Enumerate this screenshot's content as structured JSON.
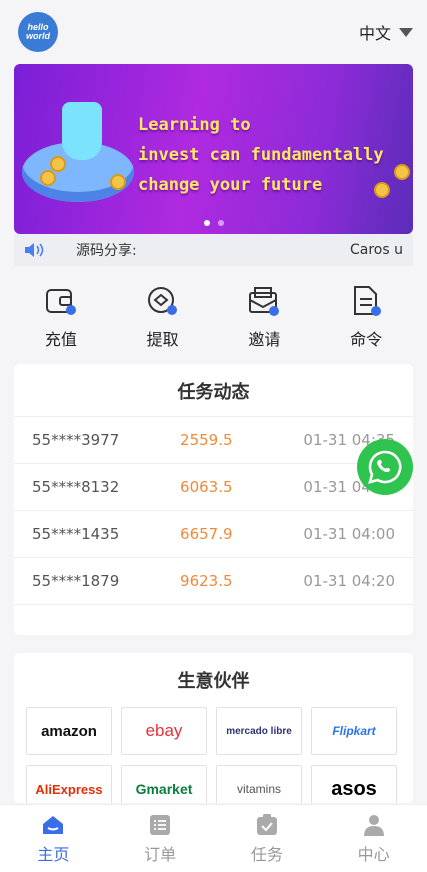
{
  "header": {
    "logo_line1": "hello",
    "logo_line2": "world",
    "language": "中文"
  },
  "banner": {
    "line1": "Learning to",
    "line2": "invest can fundamentally",
    "line3": "change your future"
  },
  "notice": {
    "label": "源码分享:",
    "scroll_text": "Caros u"
  },
  "quick_actions": [
    {
      "label": "充值",
      "icon": "wallet-icon"
    },
    {
      "label": "提取",
      "icon": "withdraw-icon"
    },
    {
      "label": "邀请",
      "icon": "invite-envelope-icon"
    },
    {
      "label": "命令",
      "icon": "document-icon"
    }
  ],
  "task_feed": {
    "title": "任务动态",
    "rows": [
      {
        "account": "55****3977",
        "amount": "2559.5",
        "time": "01-31 04:35"
      },
      {
        "account": "55****8132",
        "amount": "6063.5",
        "time": "01-31 04:40"
      },
      {
        "account": "55****1435",
        "amount": "6657.9",
        "time": "01-31 04:00"
      },
      {
        "account": "55****1879",
        "amount": "9623.5",
        "time": "01-31 04:20"
      }
    ]
  },
  "partners": {
    "title": "生意伙伴",
    "logos": [
      "amazon",
      "ebay",
      "mercado libre",
      "Flipkart",
      "AliExpress",
      "Gmarket",
      "vitamins",
      "asos"
    ]
  },
  "tabbar": [
    {
      "label": "主页",
      "icon": "home-icon",
      "active": true
    },
    {
      "label": "订单",
      "icon": "orders-icon",
      "active": false
    },
    {
      "label": "任务",
      "icon": "task-icon",
      "active": false
    },
    {
      "label": "中心",
      "icon": "user-icon",
      "active": false
    }
  ],
  "colors": {
    "accent": "#3a6ee8",
    "amount": "#f08a3a",
    "whatsapp": "#2fc44f"
  }
}
